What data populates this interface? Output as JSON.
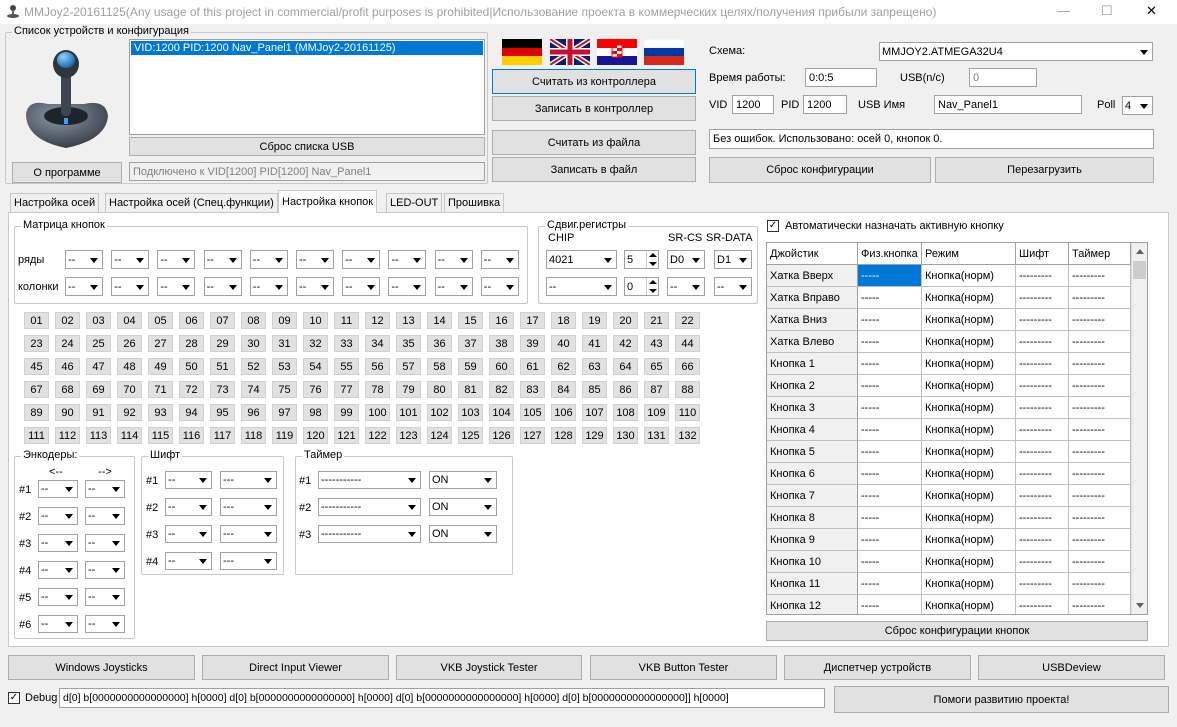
{
  "window": {
    "title": "MMJoy2-20161125(Any usage of this project in commercial/profit purposes is prohibited|Использование проекта в коммерческих целях/получения прибыли запрещено)",
    "minimize": "—",
    "maximize": "☐",
    "close": "✕"
  },
  "device": {
    "group_title": "Список устройств и конфигурация",
    "list": [
      "VID:1200 PID:1200 Nav_Panel1 (MMJoy2-20161125)"
    ],
    "reset_usb": "Сброс списка USB",
    "about": "О программе",
    "connected": "Подключено к VID[1200] PID[1200] Nav_Panel1"
  },
  "actions": {
    "read_ctrl": "Считать из контроллера",
    "write_ctrl": "Записать в контроллер",
    "read_file": "Считать из файла",
    "write_file": "Записать в файл"
  },
  "config": {
    "scheme_label": "Схема:",
    "scheme_value": "MMJOY2.ATMEGA32U4",
    "uptime_label": "Время работы:",
    "uptime_value": "0:0:5",
    "usb_label": "USB(n/c)",
    "usb_value": "0",
    "vid_label": "VID",
    "vid_value": "1200",
    "pid_label": "PID",
    "pid_value": "1200",
    "usbname_label": "USB Имя",
    "usbname_value": "Nav_Panel1",
    "poll_label": "Poll",
    "poll_value": "4",
    "status": "Без ошибок. Использовано: осей  0, кнопок  0.",
    "reset_cfg": "Сброс конфигурации",
    "reboot": "Перезагрузить"
  },
  "tabs": [
    "Настройка осей",
    "Настройка осей (Спец.функции)",
    "Настройка кнопок",
    "LED-OUT",
    "Прошивка"
  ],
  "matrix": {
    "title": "Матрица кнопок",
    "rows_label": "ряды",
    "cols_label": "колонки",
    "value": "--"
  },
  "shift_regs": {
    "title": "Сдвиг.регистры",
    "chip_label": "CHIP",
    "cs_label": "SR-CS",
    "data_label": "SR-DATA",
    "chip1": "4021",
    "num1": "5",
    "cs1": "D0",
    "data1": "D1",
    "chip2": "--",
    "num2": "0",
    "cs2": "--",
    "data2": "--"
  },
  "buttons": [
    "01",
    "02",
    "03",
    "04",
    "05",
    "06",
    "07",
    "08",
    "09",
    "10",
    "11",
    "12",
    "13",
    "14",
    "15",
    "16",
    "17",
    "18",
    "19",
    "20",
    "21",
    "22",
    "23",
    "24",
    "25",
    "26",
    "27",
    "28",
    "29",
    "30",
    "31",
    "32",
    "33",
    "34",
    "35",
    "36",
    "37",
    "38",
    "39",
    "40",
    "41",
    "42",
    "43",
    "44",
    "45",
    "46",
    "47",
    "48",
    "49",
    "50",
    "51",
    "52",
    "53",
    "54",
    "55",
    "56",
    "57",
    "58",
    "59",
    "60",
    "61",
    "62",
    "63",
    "64",
    "65",
    "66",
    "67",
    "68",
    "69",
    "70",
    "71",
    "72",
    "73",
    "74",
    "75",
    "76",
    "77",
    "78",
    "79",
    "80",
    "81",
    "82",
    "83",
    "84",
    "85",
    "86",
    "87",
    "88",
    "89",
    "90",
    "91",
    "92",
    "93",
    "94",
    "95",
    "96",
    "97",
    "98",
    "99",
    "100",
    "101",
    "102",
    "103",
    "104",
    "105",
    "106",
    "107",
    "108",
    "109",
    "110",
    "111",
    "112",
    "113",
    "114",
    "115",
    "116",
    "117",
    "118",
    "119",
    "120",
    "121",
    "122",
    "123",
    "124",
    "125",
    "126",
    "127",
    "128",
    "129",
    "130",
    "131",
    "132"
  ],
  "encoders": {
    "title": "Энкодеры:",
    "left": "<--",
    "right": "-->",
    "rows": [
      "#1",
      "#2",
      "#3",
      "#4",
      "#5",
      "#6"
    ],
    "value": "--"
  },
  "shift": {
    "title": "Шифт",
    "rows": [
      "#1",
      "#2",
      "#3",
      "#4"
    ],
    "v1": "--",
    "v2": "---"
  },
  "timer": {
    "title": "Таймер",
    "rows": [
      "#1",
      "#2",
      "#3"
    ],
    "v1": "-----------",
    "v2": "ON"
  },
  "auto_assign": "Автоматически назначать активную кнопку",
  "table": {
    "headers": [
      "Джойстик",
      "Физ.кнопка",
      "Режим",
      "Шифт",
      "Таймер"
    ],
    "rows": [
      {
        "name": "Хатка Вверх",
        "phys": "-----",
        "mode": "Кнопка(норм)",
        "shift": "---------",
        "timer": "---------"
      },
      {
        "name": "Хатка Вправо",
        "phys": "-----",
        "mode": "Кнопка(норм)",
        "shift": "---------",
        "timer": "---------"
      },
      {
        "name": "Хатка Вниз",
        "phys": "-----",
        "mode": "Кнопка(норм)",
        "shift": "---------",
        "timer": "---------"
      },
      {
        "name": "Хатка Влево",
        "phys": "-----",
        "mode": "Кнопка(норм)",
        "shift": "---------",
        "timer": "---------"
      },
      {
        "name": "Кнопка 1",
        "phys": "-----",
        "mode": "Кнопка(норм)",
        "shift": "---------",
        "timer": "---------"
      },
      {
        "name": "Кнопка 2",
        "phys": "-----",
        "mode": "Кнопка(норм)",
        "shift": "---------",
        "timer": "---------"
      },
      {
        "name": "Кнопка 3",
        "phys": "-----",
        "mode": "Кнопка(норм)",
        "shift": "---------",
        "timer": "---------"
      },
      {
        "name": "Кнопка 4",
        "phys": "-----",
        "mode": "Кнопка(норм)",
        "shift": "---------",
        "timer": "---------"
      },
      {
        "name": "Кнопка 5",
        "phys": "-----",
        "mode": "Кнопка(норм)",
        "shift": "---------",
        "timer": "---------"
      },
      {
        "name": "Кнопка 6",
        "phys": "-----",
        "mode": "Кнопка(норм)",
        "shift": "---------",
        "timer": "---------"
      },
      {
        "name": "Кнопка 7",
        "phys": "-----",
        "mode": "Кнопка(норм)",
        "shift": "---------",
        "timer": "---------"
      },
      {
        "name": "Кнопка 8",
        "phys": "-----",
        "mode": "Кнопка(норм)",
        "shift": "---------",
        "timer": "---------"
      },
      {
        "name": "Кнопка 9",
        "phys": "-----",
        "mode": "Кнопка(норм)",
        "shift": "---------",
        "timer": "---------"
      },
      {
        "name": "Кнопка 10",
        "phys": "-----",
        "mode": "Кнопка(норм)",
        "shift": "---------",
        "timer": "---------"
      },
      {
        "name": "Кнопка 11",
        "phys": "-----",
        "mode": "Кнопка(норм)",
        "shift": "---------",
        "timer": "---------"
      },
      {
        "name": "Кнопка 12",
        "phys": "-----",
        "mode": "Кнопка(норм)",
        "shift": "---------",
        "timer": "---------"
      }
    ]
  },
  "reset_buttons": "Сброс конфигурации кнопок",
  "bottom": [
    "Windows Joysticks",
    "Direct Input Viewer",
    "VKB Joystick Tester",
    "VKB Button Tester",
    "Диспетчер устройств",
    "USBDeview"
  ],
  "debug": {
    "label": "Debug",
    "value": "d[0] b[0000000000000000] h[0000]   d[0] b[0000000000000000] h[0000]   d[0] b[0000000000000000] h[0000]   d[0] b[0000000000000000]] h[0000]"
  },
  "help": "Помоги развитию проекта!",
  "colors": {
    "selection": "#0078d7",
    "accent_cell": "#0078d7"
  }
}
